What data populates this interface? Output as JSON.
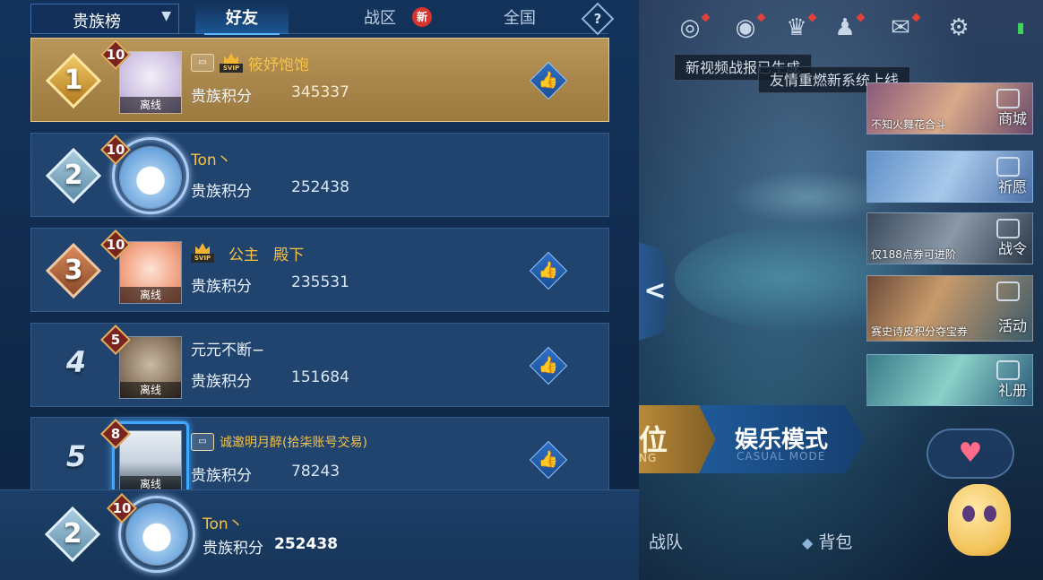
{
  "leaderboard": {
    "dropdown_label": "贵族榜",
    "tabs": [
      "好友",
      "战区",
      "全国"
    ],
    "active_tab": "好友",
    "new_badge": "新",
    "help_glyph": "?",
    "offline_label": "离线",
    "score_label": "贵族积分",
    "rows": [
      {
        "rank": "1",
        "level": "10",
        "name": "筱妤饱饱",
        "score": "345337",
        "offline": true,
        "svip": true
      },
      {
        "rank": "2",
        "level": "10",
        "name": "Ton丶",
        "score": "252438",
        "offline": false,
        "svip": false
      },
      {
        "rank": "3",
        "level": "10",
        "name": "公主   殿下",
        "score": "235531",
        "offline": true,
        "svip": true
      },
      {
        "rank": "4",
        "level": "5",
        "name": "元元不断−",
        "score": "151684",
        "offline": true,
        "svip": false
      },
      {
        "rank": "5",
        "level": "8",
        "name": "诚邀明月醉(拾柒账号交易)",
        "score": "78243",
        "offline": true,
        "svip": false
      }
    ],
    "self": {
      "rank": "2",
      "level": "10",
      "name": "Ton丶",
      "score_label": "贵族积分",
      "score": "252438"
    }
  },
  "game_ui": {
    "notices": [
      "新视频战报已生成",
      "友情重燃新系统上线"
    ],
    "side_cards": [
      {
        "label": "商城",
        "caption": "不知火舞花合斗"
      },
      {
        "label": "祈愿",
        "caption": ""
      },
      {
        "label": "战令",
        "caption": "仅188点券可进阶"
      },
      {
        "label": "活动",
        "caption": "赛史诗皮积分夺宝券"
      },
      {
        "label": "礼册",
        "caption": ""
      }
    ],
    "modes": {
      "rank_title": "位",
      "rank_sub": "NG",
      "casual_title": "娱乐模式",
      "casual_sub": "CASUAL MODE"
    },
    "bottom_nav": [
      "战队",
      "背包"
    ],
    "collapse_glyph": "<"
  },
  "colors": {
    "panel_bg": "#13335b",
    "row_bg": "#21446f",
    "first_row_gold": "#b9975a",
    "accent_blue": "#5db7ff",
    "gold_text": "#f5c244"
  }
}
